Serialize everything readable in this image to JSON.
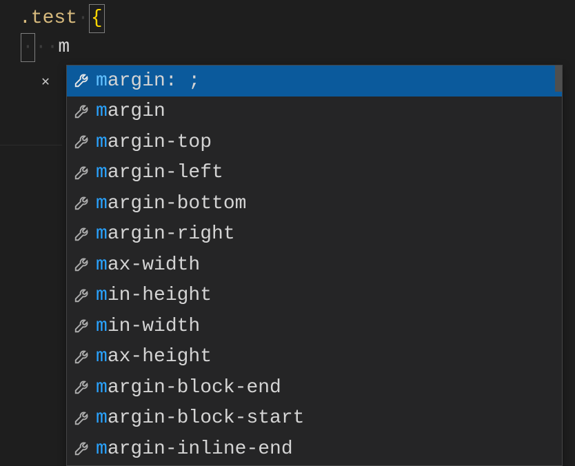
{
  "code": {
    "line1": {
      "selector": ".test",
      "space_dot": "·",
      "brace": "{"
    },
    "line2": {
      "indent_dot": "·",
      "dots": "··",
      "typed": "m"
    }
  },
  "close_label": "✕",
  "autocomplete": {
    "match": "m",
    "items": [
      {
        "text": "argin: ;",
        "selected": true
      },
      {
        "text": "argin",
        "selected": false
      },
      {
        "text": "argin-top",
        "selected": false
      },
      {
        "text": "argin-left",
        "selected": false
      },
      {
        "text": "argin-bottom",
        "selected": false
      },
      {
        "text": "argin-right",
        "selected": false
      },
      {
        "text": "ax-width",
        "selected": false
      },
      {
        "text": "in-height",
        "selected": false
      },
      {
        "text": "in-width",
        "selected": false
      },
      {
        "text": "ax-height",
        "selected": false
      },
      {
        "text": "argin-block-end",
        "selected": false
      },
      {
        "text": "argin-block-start",
        "selected": false
      },
      {
        "text": "argin-inline-end",
        "selected": false
      }
    ]
  }
}
